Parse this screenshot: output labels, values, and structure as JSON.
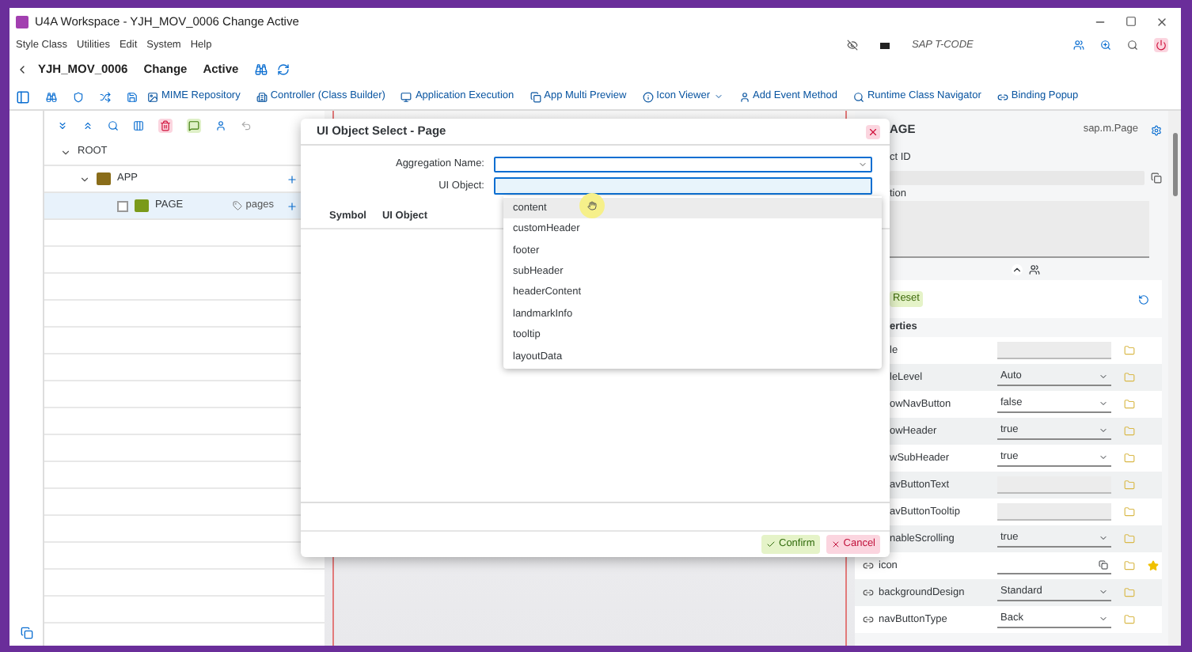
{
  "window": {
    "title": "U4A Workspace - YJH_MOV_0006 Change Active"
  },
  "menu": [
    "Style Class",
    "Utilities",
    "Edit",
    "System",
    "Help"
  ],
  "header": {
    "app": "YJH_MOV_0006",
    "mode": "Change",
    "status": "Active",
    "tcode_placeholder": "SAP T-CODE"
  },
  "toolbar": [
    "MIME Repository",
    "Controller (Class Builder)",
    "Application Execution",
    "App Multi Preview",
    "Icon Viewer",
    "Add Event Method",
    "Runtime Class Navigator",
    "Binding Popup"
  ],
  "tree": [
    {
      "label": "ROOT",
      "expanded": true,
      "selected": false,
      "children": [
        {
          "label": "APP",
          "expanded": true,
          "selected": false,
          "children": [
            {
              "label": "PAGE",
              "selected": true,
              "checked": false,
              "aggregation": "pages"
            }
          ]
        }
      ]
    }
  ],
  "dialog": {
    "title": "UI Object Select - Page",
    "aggregation_label": "Aggregation Name:",
    "object_label": "UI Object:",
    "columns": [
      "Symbol",
      "UI Object"
    ],
    "confirm": "Confirm",
    "cancel": "Cancel",
    "options": [
      {
        "label": "content",
        "selected": true
      },
      {
        "label": "customHeader",
        "selected": false
      },
      {
        "label": "footer",
        "selected": false
      },
      {
        "label": "subHeader",
        "selected": false
      },
      {
        "label": "headerContent",
        "selected": false
      },
      {
        "label": "landmarkInfo",
        "selected": false
      },
      {
        "label": "tooltip",
        "selected": false
      },
      {
        "label": "layoutData",
        "selected": false
      }
    ]
  },
  "properties": {
    "title": "AGE",
    "class_name": "sap.m.Page",
    "id_label": "ct ID",
    "description_label": "tion",
    "reset": "Reset",
    "section": "erties",
    "rows": [
      {
        "label": "le",
        "binding": false,
        "kind": "input",
        "starred": false
      },
      {
        "label": "leLevel",
        "binding": false,
        "kind": "select",
        "value": "Auto",
        "starred": false
      },
      {
        "label": "owNavButton",
        "binding": false,
        "kind": "select",
        "value": "false",
        "starred": false
      },
      {
        "label": "owHeader",
        "binding": false,
        "kind": "select",
        "value": "true",
        "starred": false
      },
      {
        "label": "wSubHeader",
        "binding": false,
        "kind": "select",
        "value": "true",
        "starred": false
      },
      {
        "label": "avButtonText",
        "binding": false,
        "kind": "input",
        "starred": false
      },
      {
        "label": "avButtonTooltip",
        "binding": false,
        "kind": "input",
        "starred": false
      },
      {
        "label": "nableScrolling",
        "binding": false,
        "kind": "select",
        "value": "true",
        "starred": false
      },
      {
        "label": "icon",
        "binding": true,
        "kind": "icon-input",
        "starred": true
      },
      {
        "label": "backgroundDesign",
        "binding": true,
        "kind": "select",
        "value": "Standard",
        "starred": false
      },
      {
        "label": "navButtonType",
        "binding": true,
        "kind": "select",
        "value": "Back",
        "starred": false
      }
    ]
  }
}
